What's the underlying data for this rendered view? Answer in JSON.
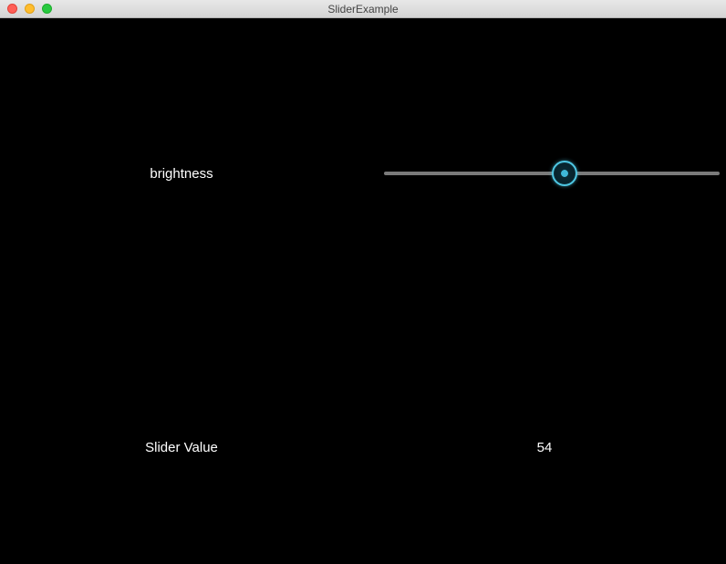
{
  "window": {
    "title": "SliderExample"
  },
  "slider": {
    "label": "brightness",
    "value": 54,
    "min": 0,
    "max": 100
  },
  "readout": {
    "label": "Slider Value",
    "value": "54"
  }
}
